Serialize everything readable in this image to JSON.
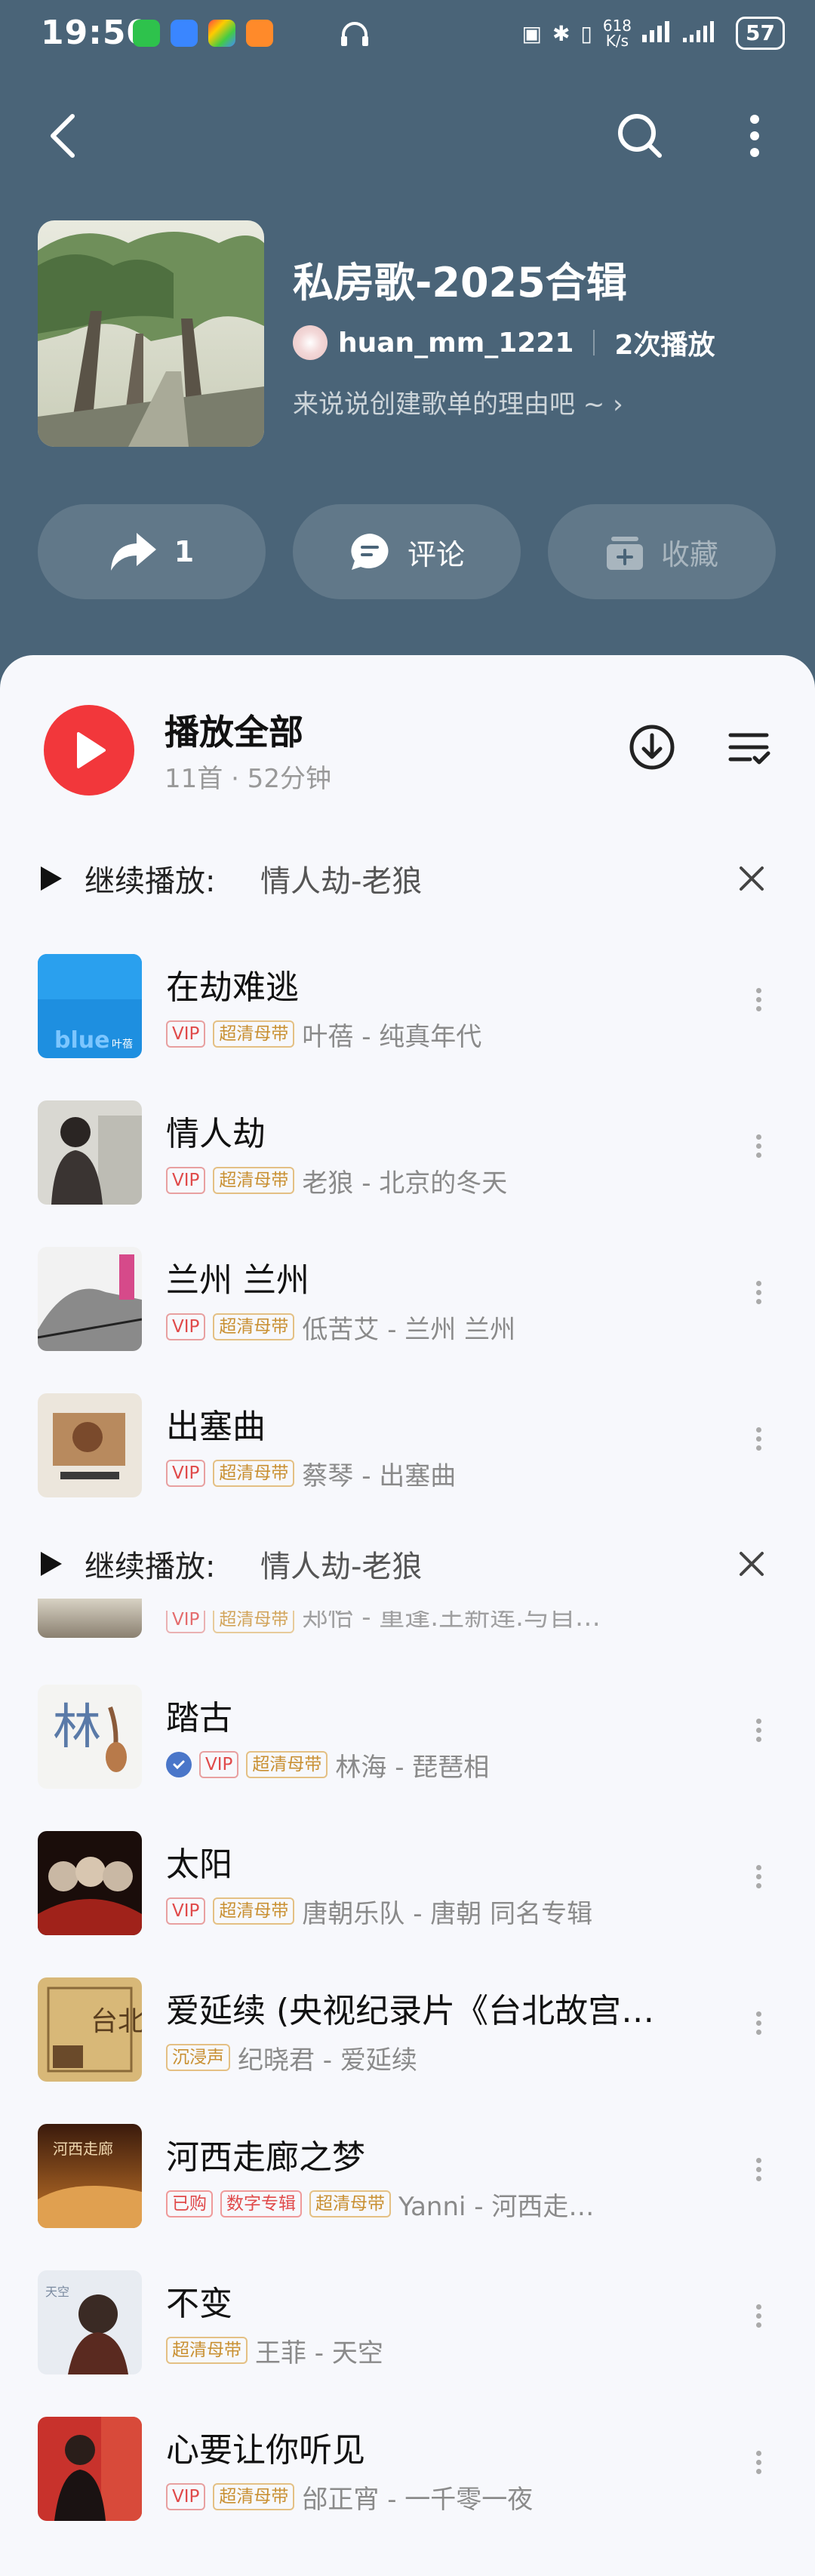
{
  "status_bar": {
    "time": "19:50",
    "net_speed": "618\nK/s",
    "battery": "57"
  },
  "header": {
    "title": "私房歌-2025合辑",
    "creator": "huan_mm_1221",
    "play_count": "2次播放",
    "reason": "来说说创建歌单的理由吧 ~ ",
    "share_count": "1",
    "comment_label": "评论",
    "collect_label": "收藏"
  },
  "play_all": {
    "label": "播放全部",
    "meta": "11首 · 52分钟"
  },
  "continue_bar": {
    "label": "继续播放:",
    "song": "情人劫-老狼"
  },
  "partial_row": {
    "subtitle": "郑怡 - 重逢.王新莲.与自…"
  },
  "songs": [
    {
      "title": "在劫难逃",
      "tags": [
        "VIP",
        "超清母带"
      ],
      "artist": "叶蓓 - 纯真年代"
    },
    {
      "title": "情人劫",
      "tags": [
        "VIP",
        "超清母带"
      ],
      "artist": "老狼 - 北京的冬天"
    },
    {
      "title": "兰州 兰州",
      "tags": [
        "VIP",
        "超清母带"
      ],
      "artist": "低苦艾 - 兰州 兰州"
    },
    {
      "title": "出塞曲",
      "tags": [
        "VIP",
        "超清母带"
      ],
      "artist": "蔡琴 - 出塞曲"
    },
    {
      "title": "踏古",
      "tags": [
        "VIP",
        "超清母带"
      ],
      "artist": "林海 - 琵琶相"
    },
    {
      "title": "太阳",
      "tags": [
        "VIP",
        "超清母带"
      ],
      "artist": "唐朝乐队 - 唐朝 同名专辑"
    },
    {
      "title": "爱延续 (央视纪录片《台北故宫…",
      "tags": [
        "沉浸声"
      ],
      "artist": "纪晓君 - 爱延续"
    },
    {
      "title": "河西走廊之梦",
      "tags": [
        "已购",
        "数字专辑",
        "超清母带"
      ],
      "artist": "Yanni - 河西走…"
    },
    {
      "title": "不变",
      "tags": [
        "超清母带"
      ],
      "artist": "王菲 - 天空"
    },
    {
      "title": "心要让你听见",
      "tags": [
        "VIP",
        "超清母带"
      ],
      "artist": "邰正宵 - 一千零一夜"
    }
  ],
  "colors": {
    "header_bg": "#4a6478",
    "accent": "#f2373b",
    "vip": "#e04a4a",
    "gold": "#c99032"
  }
}
